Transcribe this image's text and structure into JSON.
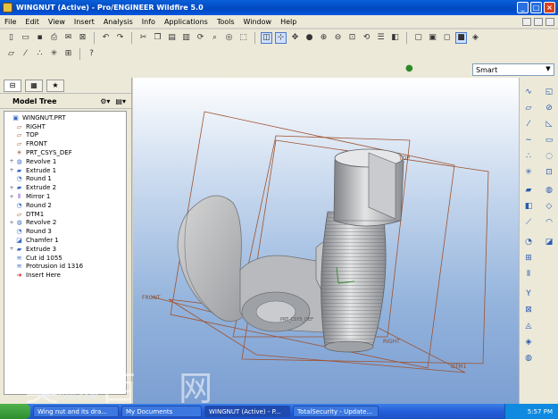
{
  "window": {
    "title": "WINGNUT (Active) - Pro/ENGINEER Wildfire 5.0"
  },
  "menu": [
    "File",
    "Edit",
    "View",
    "Insert",
    "Analysis",
    "Info",
    "Applications",
    "Tools",
    "Window",
    "Help"
  ],
  "filter_select": {
    "value": "Smart"
  },
  "model_tree": {
    "header": "Model Tree",
    "items": [
      {
        "label": "WINGNUT.PRT",
        "icon": "part-icon",
        "expander": false
      },
      {
        "label": "RIGHT",
        "icon": "datum-plane-icon",
        "expander": false
      },
      {
        "label": "TOP",
        "icon": "datum-plane-icon",
        "expander": false
      },
      {
        "label": "FRONT",
        "icon": "datum-plane-icon",
        "expander": false
      },
      {
        "label": "PRT_CSYS_DEF",
        "icon": "csys-icon",
        "expander": false
      },
      {
        "label": "Revolve 1",
        "icon": "revolve-icon",
        "expander": true
      },
      {
        "label": "Extrude 1",
        "icon": "extrude-icon",
        "expander": true
      },
      {
        "label": "Round 1",
        "icon": "round-icon",
        "expander": false
      },
      {
        "label": "Extrude 2",
        "icon": "extrude-icon",
        "expander": true
      },
      {
        "label": "Mirror 1",
        "icon": "mirror-icon",
        "expander": true
      },
      {
        "label": "Round 2",
        "icon": "round-icon",
        "expander": false
      },
      {
        "label": "DTM1",
        "icon": "datum-plane-icon",
        "expander": false
      },
      {
        "label": "Revolve 2",
        "icon": "revolve-icon",
        "expander": true
      },
      {
        "label": "Round 3",
        "icon": "round-icon",
        "expander": false
      },
      {
        "label": "Chamfer 1",
        "icon": "chamfer-icon",
        "expander": false
      },
      {
        "label": "Extrude 3",
        "icon": "extrude-icon",
        "expander": true
      },
      {
        "label": "Cut id 1055",
        "icon": "cosmetic-icon",
        "expander": false
      },
      {
        "label": "Protrusion id 1316",
        "icon": "cosmetic-icon",
        "expander": false
      },
      {
        "label": "Insert Here",
        "icon": "insert-arrow-icon",
        "expander": false
      }
    ]
  },
  "viewport": {
    "datum_labels": {
      "right": "RIGHT",
      "top": "TOP",
      "front": "FRONT",
      "dtm1": "DTM1",
      "csys": "PRT_CSYS_DEF"
    }
  },
  "taskbar": {
    "tasks": [
      "Wing nut and its dra...",
      "My Documents",
      "WINGNUT (Active) - P...",
      "TotalSecurity - Update..."
    ],
    "clock": "5:57 PM"
  },
  "watermark": {
    "text": "莫 西 网",
    "sub": "mocxw.com"
  },
  "colors": {
    "titlebar": "#0a5fd8",
    "viewport_top": "#ffffff",
    "viewport_bottom": "#7c9fd2",
    "part": "#c8c8c8",
    "datum": "#a0522d"
  }
}
